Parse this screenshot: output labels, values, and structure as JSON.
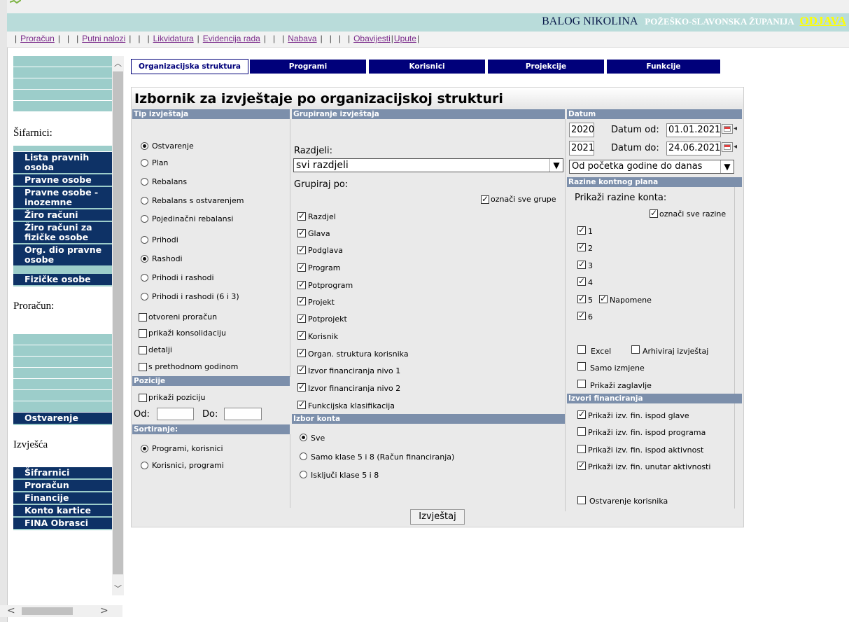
{
  "header": {
    "user_name": "BALOG NIKOLINA",
    "county": "POŽEŠKO-SLAVONSKA ŽUPANIJA",
    "logout": "ODJAVA"
  },
  "menu": {
    "items": [
      "Proračun",
      "Putni nalozi",
      "Likvidatura",
      "Evidencija rada",
      "Nabava",
      "Obavijesti",
      "Upute"
    ]
  },
  "sidebar": {
    "section_sifarnici": "Šifarnici:",
    "sifarnici_items": [
      "Lista pravnih osoba",
      "Pravne osobe",
      "Pravne osobe - inozemne",
      "Žiro računi",
      "Žiro računi za fizičke osobe",
      "Org. dio pravne osobe",
      "Fizičke osobe"
    ],
    "section_proracun": "Proračun:",
    "proracun_items": [
      "Ostvarenje"
    ],
    "section_izvjesca": "Izvješća",
    "izvjesca_items": [
      "Šifrarnici",
      "Proračun",
      "Financije",
      "Konto kartice",
      "FINA Obrasci"
    ]
  },
  "tabs": [
    "Organizacijska struktura",
    "Programi",
    "Korisnici",
    "Projekcije",
    "Funkcije"
  ],
  "panel": {
    "title": "Izbornik za izvještaje po organizacijskoj strukturi",
    "tip_izvjestaja": {
      "header": "Tip izvještaja",
      "options": [
        {
          "label": "Ostvarenje",
          "selected": true
        },
        {
          "label": "Plan",
          "selected": false
        },
        {
          "label": "Rebalans",
          "selected": false
        },
        {
          "label": "Rebalans s ostvarenjem",
          "selected": false
        },
        {
          "label": "Pojedinačni rebalansi",
          "selected": false
        }
      ],
      "options2": [
        {
          "label": "Prihodi",
          "selected": false
        },
        {
          "label": "Rashodi",
          "selected": true
        },
        {
          "label": "Prihodi i rashodi",
          "selected": false
        },
        {
          "label": "Prihodi i rashodi (6 i 3)",
          "selected": false
        }
      ],
      "checks": [
        {
          "label": "otvoreni proračun",
          "checked": false
        },
        {
          "label": "prikaži konsolidaciju",
          "checked": false
        },
        {
          "label": "detalji",
          "checked": false
        },
        {
          "label": "s prethodnom godinom",
          "checked": false
        }
      ]
    },
    "pozicije": {
      "header": "Pozicije",
      "check_label": "prikaži poziciju",
      "od_label": "Od:",
      "do_label": "Do:",
      "od_value": "",
      "do_value": ""
    },
    "sortiranje": {
      "header": "Sortiranje:",
      "options": [
        {
          "label": "Programi, korisnici",
          "selected": true
        },
        {
          "label": "Korisnici, programi",
          "selected": false
        }
      ]
    },
    "grupiranje": {
      "header": "Grupiranje izvještaja",
      "razdjeli_label": "Razdjeli:",
      "razdjeli_value": "svi razdjeli",
      "grupiraj_label": "Grupiraj po:",
      "oznaci_sve": "označi sve grupe",
      "items": [
        "Razdjel",
        "Glava",
        "Podglava",
        "Program",
        "Potprogram",
        "Projekt",
        "Potprojekt",
        "Korisnik",
        "Organ. struktura korisnika",
        "Izvor financiranja nivo 1",
        "Izvor financiranja nivo 2",
        "Funkcijska klasifikacija"
      ]
    },
    "izbor_konta": {
      "header": "Izbor konta",
      "options": [
        {
          "label": "Sve",
          "selected": true
        },
        {
          "label": "Samo klase 5 i 8 (Račun financiranja)",
          "selected": false
        },
        {
          "label": "Isključi klase 5 i 8",
          "selected": false
        }
      ]
    },
    "datum": {
      "header": "Datum",
      "year_from": "2020",
      "year_to": "2021",
      "datum_od_label": "Datum od:",
      "datum_do_label": "Datum do:",
      "datum_od": "01.01.2021",
      "datum_do": "24.06.2021",
      "period": "Od početka godine do danas"
    },
    "razine": {
      "header": "Razine kontnog plana",
      "prikazi_label": "Prikaži razine konta:",
      "oznaci_sve": "označi sve razine",
      "levels": [
        "1",
        "2",
        "3",
        "4",
        "5",
        "6"
      ],
      "napomene": "Napomene"
    },
    "opcije": {
      "excel": "Excel",
      "arhiviraj": "Arhiviraj izvještaj",
      "samo_izmjene": "Samo izmjene",
      "prikazi_zaglavlje": "Prikaži zaglavlje"
    },
    "izvori": {
      "header": "Izvori financiranja",
      "items": [
        {
          "label": "Prikaži izv. fin. ispod glave",
          "checked": true
        },
        {
          "label": "Prikaži izv. fin. ispod programa",
          "checked": false
        },
        {
          "label": "Prikaži izv. fin. ispod aktivnost",
          "checked": false
        },
        {
          "label": "Prikaži izv. fin. unutar aktivnosti",
          "checked": true
        }
      ],
      "ostvarenje_korisnika": "Ostvarenje korisnika"
    },
    "submit": "Izvještaj"
  },
  "colors": {
    "nav_dark": "#0e3266",
    "tile_teal": "#9ccdca",
    "section_header": "#7c8fab",
    "tab_blue": "#00007a"
  }
}
